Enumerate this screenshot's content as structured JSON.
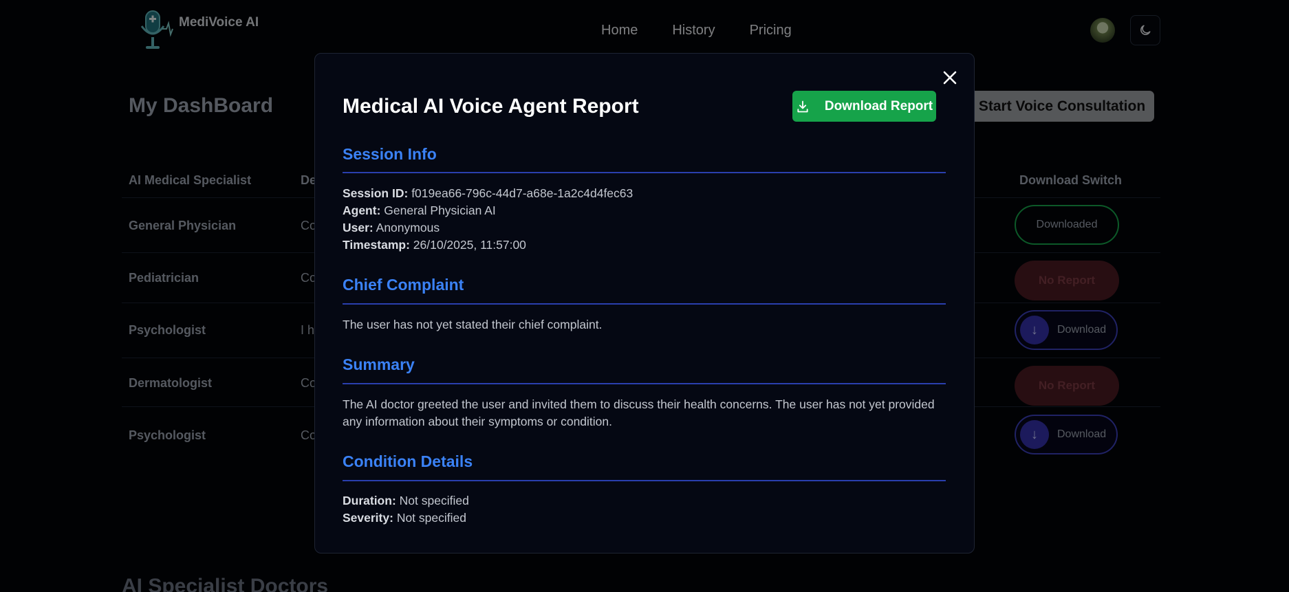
{
  "app": {
    "logo_text": "MediVoice AI",
    "nav": [
      "Home",
      "History",
      "Pricing"
    ]
  },
  "dashboard": {
    "title": "My DashBoard",
    "start_button": "Start Voice Consultation",
    "columns": [
      "AI Medical Specialist",
      "De",
      "Download Switch"
    ],
    "rows": [
      {
        "specialist": "General Physician",
        "desc": "Co",
        "status": "Downloaded"
      },
      {
        "specialist": "Pediatrician",
        "desc": "Co",
        "status": "No Report"
      },
      {
        "specialist": "Psychologist",
        "desc": "I h",
        "status": "Download"
      },
      {
        "specialist": "Dermatologist",
        "desc": "Co",
        "status": "No Report"
      },
      {
        "specialist": "Psychologist",
        "desc": "Co",
        "status": "Download"
      }
    ],
    "specialists_title": "AI Specialist Doctors"
  },
  "modal": {
    "title": "Medical AI Voice Agent Report",
    "download_button": "Download Report",
    "session_info": {
      "heading": "Session Info",
      "session_id_label": "Session ID:",
      "session_id": "f019ea66-796c-44d7-a68e-1a2c4d4fec63",
      "agent_label": "Agent:",
      "agent": "General Physician AI",
      "user_label": "User:",
      "user": "Anonymous",
      "timestamp_label": "Timestamp:",
      "timestamp": "26/10/2025, 11:57:00"
    },
    "chief_complaint": {
      "heading": "Chief Complaint",
      "text": "The user has not yet stated their chief complaint."
    },
    "summary": {
      "heading": "Summary",
      "text": "The AI doctor greeted the user and invited them to discuss their health concerns. The user has not yet provided any information about their symptoms or condition."
    },
    "condition_details": {
      "heading": "Condition Details",
      "duration_label": "Duration:",
      "duration": "Not specified",
      "severity_label": "Severity:",
      "severity": "Not specified"
    }
  },
  "icons": {
    "close": "close-icon",
    "download": "download-icon",
    "theme": "moon-icon",
    "logo": "microphone-logo-icon",
    "arrow": "arrow-down-icon"
  },
  "colors": {
    "accent_blue": "#3b82f6",
    "success_green": "#16a34a",
    "no_report_bg": "#4a1a22",
    "download_purple": "#3330a8"
  }
}
